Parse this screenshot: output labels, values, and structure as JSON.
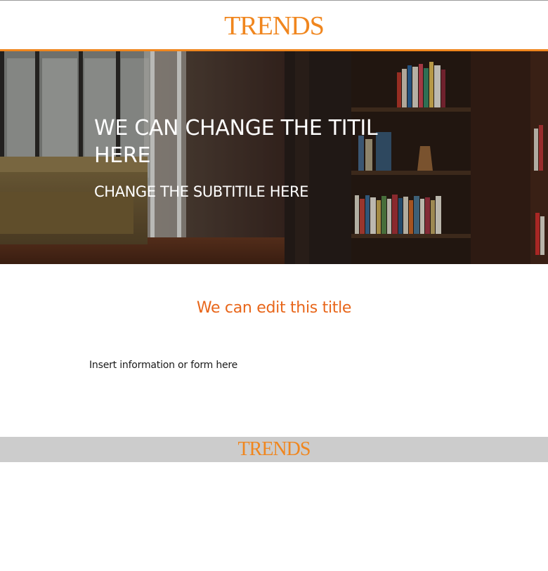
{
  "header": {
    "logo_text": "TRENDS"
  },
  "hero": {
    "title": "WE CAN CHANGE THE TITIL HERE",
    "subtitle": "CHANGE THE SUBTITILE HERE"
  },
  "content": {
    "section_title": "We can edit this title",
    "info_text": "Insert information or form here"
  },
  "footer": {
    "logo_text": "TRENDS"
  },
  "colors": {
    "brand_orange": "#f0861e",
    "title_orange": "#e8661a",
    "footer_gray": "#cccccc"
  }
}
